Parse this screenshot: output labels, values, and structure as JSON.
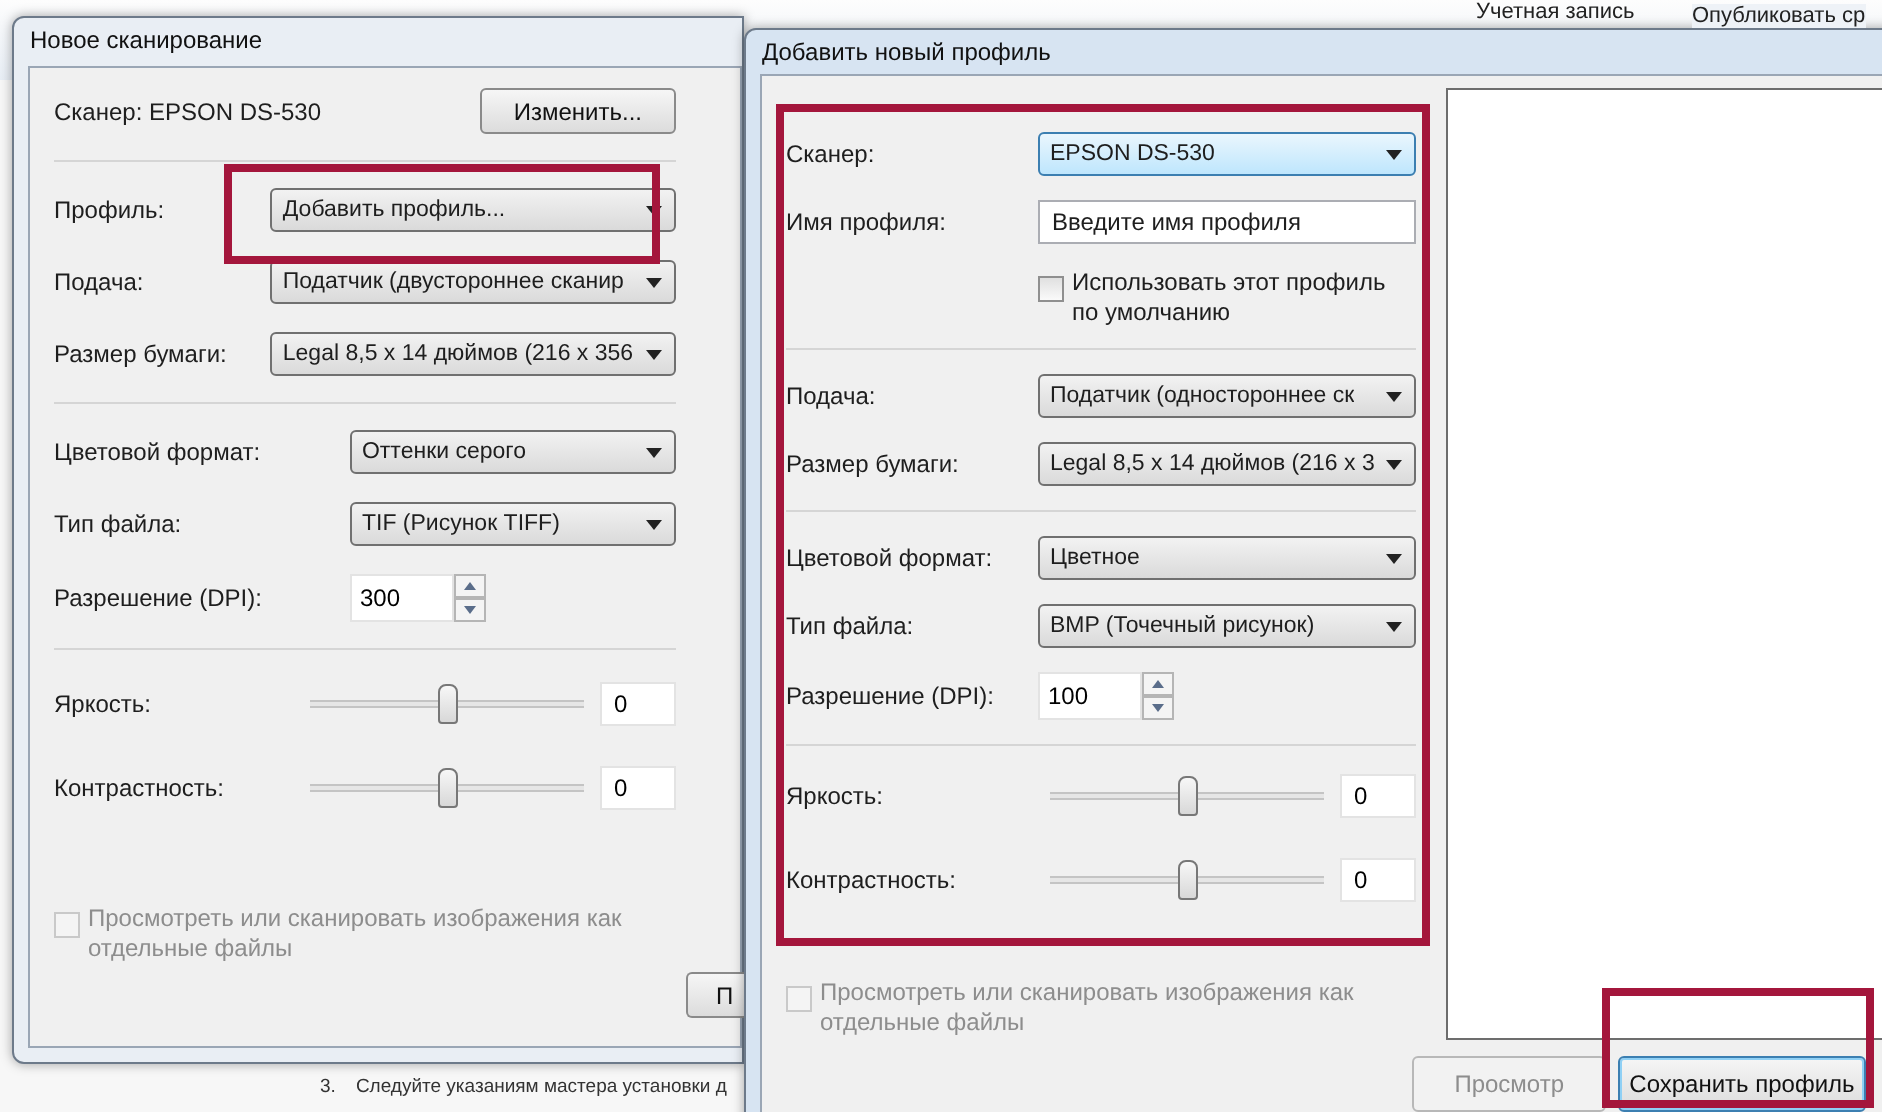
{
  "background": {
    "header": [
      "Учетная запись",
      "Опубликовать ср"
    ],
    "step": {
      "number": "3.",
      "text": "Следуйте указаниям мастера установки д"
    }
  },
  "scan_window": {
    "title": "Новое сканирование",
    "groups": [
      [
        {
          "kind": "info",
          "label": "Сканер: EPSON DS-530",
          "button": "Изменить..."
        }
      ],
      [
        {
          "kind": "combo",
          "label": "Профиль:",
          "value": "Добавить профиль...",
          "focused": false
        },
        {
          "kind": "combo",
          "label": "Подача:",
          "value": "Податчик (двустороннее сканир",
          "focused": false
        },
        {
          "kind": "combo",
          "label": "Размер бумаги:",
          "value": "Legal 8,5 x 14 дюймов (216 x 356",
          "focused": false
        }
      ],
      [
        {
          "kind": "combo",
          "label": "Цветовой формат:",
          "value": "Оттенки серого",
          "focused": false
        },
        {
          "kind": "combo",
          "label": "Тип файла:",
          "value": "TIF (Рисунок TIFF)",
          "focused": false
        },
        {
          "kind": "spinner",
          "label": "Разрешение (DPI):",
          "value": "300"
        }
      ],
      [
        {
          "kind": "slider",
          "label": "Яркость:",
          "level": 0.5,
          "value": "0"
        },
        {
          "kind": "slider",
          "label": "Контрастность:",
          "level": 0.5,
          "value": "0"
        }
      ]
    ],
    "checkbox": {
      "label": "Просмотреть или сканировать изображения как отдельные файлы",
      "checked": false,
      "disabled": true
    },
    "button": {
      "label": "П",
      "disabled": false
    }
  },
  "profile_window": {
    "title": "Добавить новый профиль",
    "groups": [
      [
        {
          "kind": "combo",
          "label": "Сканер:",
          "value": "EPSON DS-530",
          "focused": true
        },
        {
          "kind": "text",
          "label": "Имя профиля:",
          "placeholder": "Введите имя профиля"
        },
        {
          "kind": "check",
          "label": "Использовать этот профиль по умолчанию",
          "checked": false,
          "disabled": false
        }
      ],
      [
        {
          "kind": "combo",
          "label": "Подача:",
          "value": "Податчик (одностороннее ск",
          "focused": false
        },
        {
          "kind": "combo",
          "label": "Размер бумаги:",
          "value": "Legal 8,5 x 14 дюймов (216 x 3",
          "focused": false
        }
      ],
      [
        {
          "kind": "combo",
          "label": "Цветовой формат:",
          "value": "Цветное",
          "focused": false
        },
        {
          "kind": "combo",
          "label": "Тип файла:",
          "value": "BMP (Точечный рисунок)",
          "focused": false
        },
        {
          "kind": "spinner",
          "label": "Разрешение (DPI):",
          "value": "100"
        }
      ],
      [
        {
          "kind": "slider",
          "label": "Яркость:",
          "level": 0.5,
          "value": "0"
        },
        {
          "kind": "slider",
          "label": "Контрастность:",
          "level": 0.5,
          "value": "0"
        }
      ]
    ],
    "checkbox": {
      "label": "Просмотреть или сканировать изображения как отдельные файлы",
      "checked": false,
      "disabled": true
    },
    "buttons": [
      {
        "label": "Просмотр",
        "disabled": true,
        "default": false
      },
      {
        "label": "Сохранить профиль",
        "disabled": false,
        "default": true
      }
    ]
  }
}
